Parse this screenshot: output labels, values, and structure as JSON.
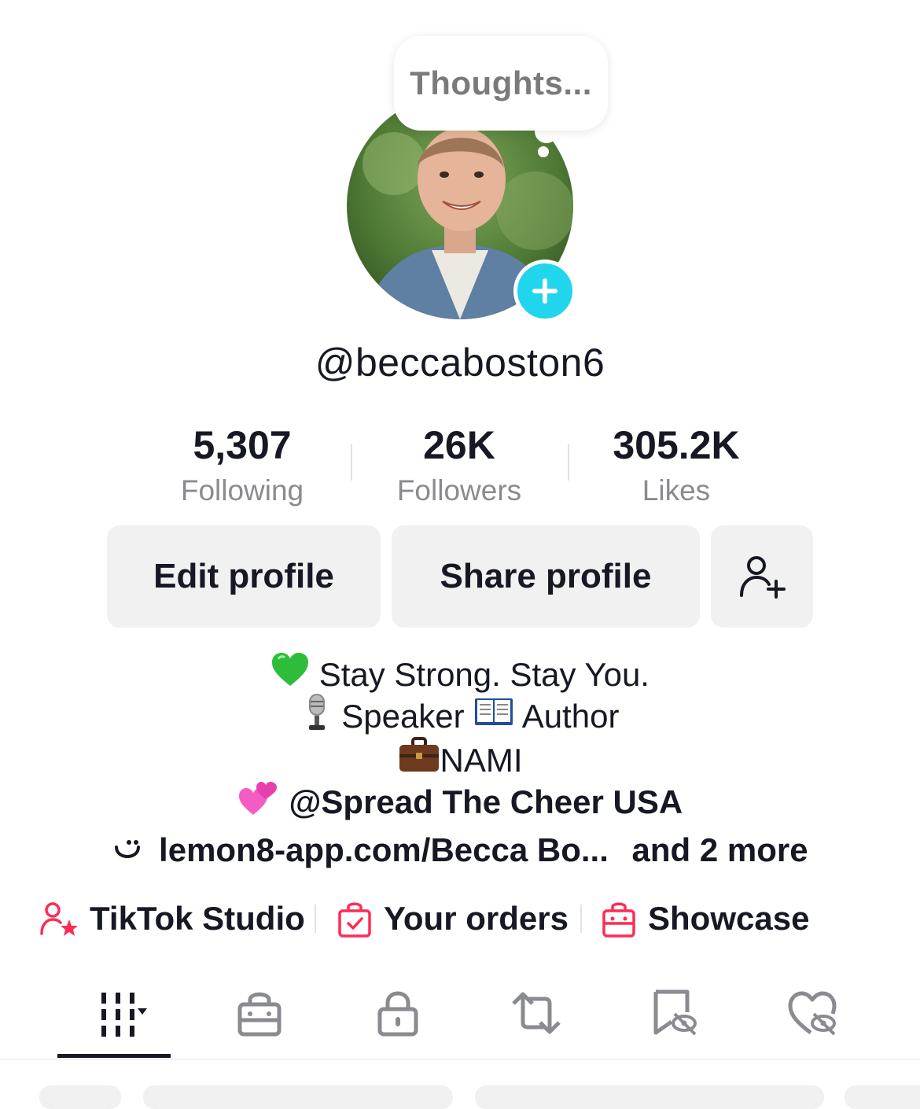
{
  "bubble": {
    "text": "Thoughts..."
  },
  "profile": {
    "username": "@beccaboston6"
  },
  "stats": [
    {
      "value": "5,307",
      "label": "Following"
    },
    {
      "value": "26K",
      "label": "Followers"
    },
    {
      "value": "305.2K",
      "label": "Likes"
    }
  ],
  "buttons": {
    "edit": "Edit profile",
    "share": "Share profile",
    "add_friend_icon": "person-add-icon"
  },
  "bio": {
    "line1": {
      "emoji": "💚",
      "text": "Stay Strong. Stay You."
    },
    "line2": {
      "emoji1": "🎙️",
      "text1": "Speaker",
      "emoji2": "📖",
      "text2": "Author"
    },
    "line3": {
      "emoji": "💼",
      "text": "NAMI"
    },
    "line4": {
      "emoji": "💞",
      "text": "@Spread The Cheer USA"
    }
  },
  "link": {
    "icon": "link-smile-icon",
    "url": "lemon8-app.com/Becca  Bo...",
    "more": "and 2 more"
  },
  "shortcuts": [
    {
      "icon": "creator-star-icon",
      "label": "TikTok Studio"
    },
    {
      "icon": "shopping-bag-check-icon",
      "label": "Your orders"
    },
    {
      "icon": "shop-bag-icon",
      "label": "Showcase"
    }
  ],
  "tabs": [
    {
      "icon": "grid-videos-icon",
      "active": true
    },
    {
      "icon": "shop-icon",
      "active": false
    },
    {
      "icon": "lock-icon",
      "active": false
    },
    {
      "icon": "repost-icon",
      "active": false
    },
    {
      "icon": "favorites-hidden-icon",
      "active": false
    },
    {
      "icon": "liked-hidden-icon",
      "active": false
    }
  ],
  "colors": {
    "accent_cyan": "#20d5ec",
    "accent_red": "#fe2c55",
    "text_primary": "#161823",
    "text_secondary": "#8a8b91",
    "button_bg": "#f1f1f2"
  }
}
